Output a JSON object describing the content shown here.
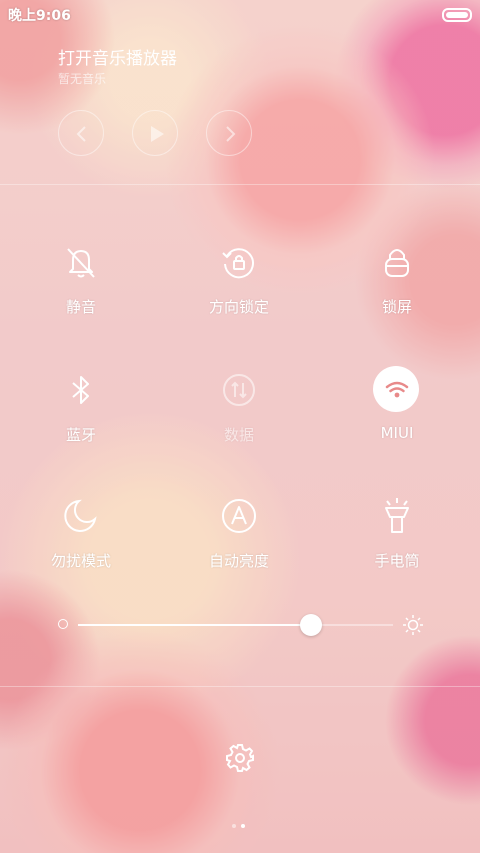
{
  "statusbar": {
    "time": "晚上9:06"
  },
  "music": {
    "title": "打开音乐播放器",
    "subtitle": "暂无音乐",
    "controls": [
      "previous-icon",
      "play-icon",
      "next-icon"
    ]
  },
  "toggles": [
    {
      "label": "静音",
      "icon": "mute-bell-icon",
      "state": "off"
    },
    {
      "label": "方向锁定",
      "icon": "rotation-lock-icon",
      "state": "off"
    },
    {
      "label": "锁屏",
      "icon": "lock-icon",
      "state": "off"
    },
    {
      "label": "蓝牙",
      "icon": "bluetooth-icon",
      "state": "off"
    },
    {
      "label": "数据",
      "icon": "mobile-data-icon",
      "state": "disabled"
    },
    {
      "label": "MIUI",
      "icon": "wifi-icon",
      "state": "on"
    },
    {
      "label": "勿扰模式",
      "icon": "moon-icon",
      "state": "off"
    },
    {
      "label": "自动亮度",
      "icon": "auto-brightness-icon",
      "state": "off"
    },
    {
      "label": "手电筒",
      "icon": "flashlight-icon",
      "state": "off"
    }
  ],
  "brightness": {
    "level": 0.74
  },
  "pager": {
    "pages": 2,
    "current": 2
  },
  "colors": {
    "accent_wifi": "#e88a8a",
    "icon": "#ffffff"
  }
}
